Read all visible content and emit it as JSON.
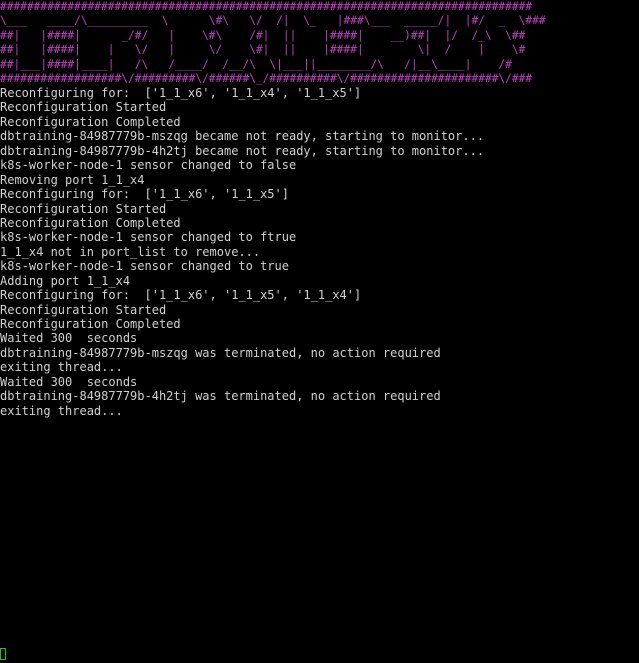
{
  "terminal": {
    "banner_lines": [
      "###############################################################################",
      "\\___   ____/\\_________  \\      \\#\\   \\/  /|  \\_   |###\\___  _____/|  |#/  _  \\###",
      "##|   |####|      _/#/   |    \\#\\    /#|  ||    |####|    __)##|  |/  /_\\  \\##",
      "##|   |####|    |   \\/   |     \\/    \\#|  ||    |####|        \\|  /    |    \\#",
      "##|___|####|____|   /\\   /____/  /__/\\  \\|___||________/\\   /|__\\____|    /#",
      "##################\\/#########\\/######\\_/##########\\/######################\\/###"
    ],
    "output_lines": [
      "Reconfiguring for:  ['1_1_x6', '1_1_x4', '1_1_x5']",
      "Reconfiguration Started",
      "Reconfiguration Completed",
      "dbtraining-84987779b-mszqg became not ready, starting to monitor...",
      "dbtraining-84987779b-4h2tj became not ready, starting to monitor...",
      "k8s-worker-node-1 sensor changed to false",
      "Removing port 1_1_x4",
      "Reconfiguring for:  ['1_1_x6', '1_1_x5']",
      "Reconfiguration Started",
      "Reconfiguration Completed",
      "k8s-worker-node-1 sensor changed to ftrue",
      "1_1_x4 not in port_list to remove...",
      "k8s-worker-node-1 sensor changed to true",
      "Adding port 1_1_x4",
      "Reconfiguring for:  ['1_1_x6', '1_1_x5', '1_1_x4']",
      "Reconfiguration Started",
      "Reconfiguration Completed",
      "Waited 300  seconds",
      "dbtraining-84987779b-mszqg was terminated, no action required",
      "exiting thread...",
      "Waited 300  seconds",
      "dbtraining-84987779b-4h2tj was terminated, no action required",
      "exiting thread..."
    ],
    "colors": {
      "background": "#000000",
      "banner": "#c040c0",
      "text": "#d0d0d0",
      "cursor": "#20c020"
    }
  }
}
